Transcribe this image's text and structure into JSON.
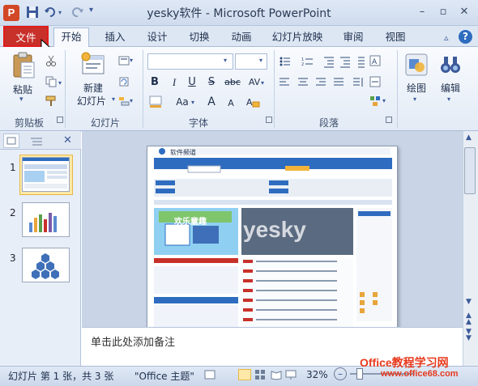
{
  "window": {
    "title": "yesky软件 - Microsoft PowerPoint",
    "app_icon_letter": "P"
  },
  "tabs": [
    {
      "label": "文件"
    },
    {
      "label": "开始"
    },
    {
      "label": "插入"
    },
    {
      "label": "设计"
    },
    {
      "label": "切换"
    },
    {
      "label": "动画"
    },
    {
      "label": "幻灯片放映"
    },
    {
      "label": "审阅"
    },
    {
      "label": "视图"
    }
  ],
  "ribbon": {
    "clipboard": {
      "group_label": "剪贴板",
      "paste_label": "粘贴"
    },
    "slides": {
      "group_label": "幻灯片",
      "new_slide_line1": "新建",
      "new_slide_line2": "幻灯片"
    },
    "font": {
      "group_label": "字体",
      "bold": "B",
      "italic": "I",
      "underline": "U",
      "strike": "S",
      "shadow_label": "abc",
      "spacing": "AV",
      "case": "Aa",
      "grow": "A",
      "shrink": "A"
    },
    "paragraph": {
      "group_label": "段落"
    },
    "drawing": {
      "label": "绘图"
    },
    "editing": {
      "label": "编辑"
    }
  },
  "slides_pane": {
    "slide_numbers": [
      "1",
      "2",
      "3"
    ]
  },
  "slide_content": {
    "site_title": "软件频道",
    "watermark_text": "yesky",
    "banner_text": "欢乐童趣"
  },
  "notes": {
    "placeholder": "单击此处添加备注"
  },
  "status": {
    "slide_info": "幻灯片 第 1 张，共 3 张",
    "theme": "\"Office 主题\"",
    "zoom": "32%"
  },
  "watermark": {
    "line1": "Office教程学习网",
    "line2": "www.office68.com"
  },
  "colors": {
    "accent": "#d24726",
    "file_tab": "#c8302a",
    "highlight_border": "#e01c1c"
  }
}
